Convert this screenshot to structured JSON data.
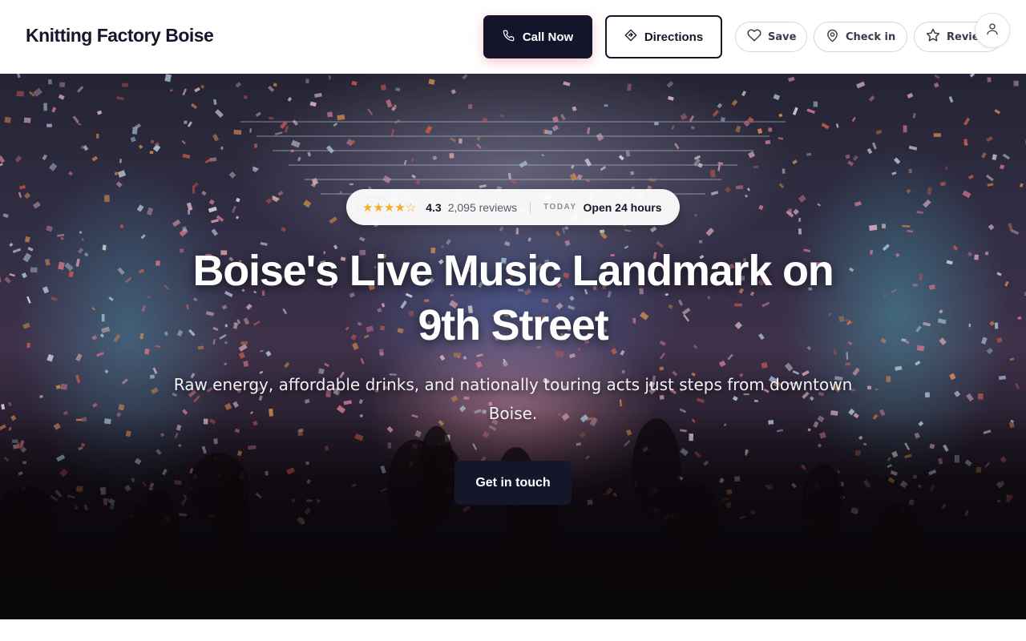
{
  "header": {
    "brand": "Knitting Factory Boise",
    "call_label": "Call Now",
    "directions_label": "Directions",
    "save_label": "Save",
    "checkin_label": "Check in",
    "review_label": "Review"
  },
  "hero": {
    "rating": {
      "stars_full": "★★★★",
      "stars_partial": "☆",
      "score": "4.3",
      "reviews": "2,095 reviews",
      "today_label": "TODAY",
      "hours": "Open 24 hours"
    },
    "headline": "Boise's Live Music Landmark on 9th Street",
    "subline": "Raw energy, affordable drinks, and nationally touring acts just steps from downtown Boise.",
    "cta_label": "Get in touch"
  },
  "colors": {
    "primary": "#16162a",
    "star": "#f2b01e",
    "background": "#ffffff"
  },
  "icons": {
    "call": "phone-icon",
    "directions": "directions-icon",
    "save": "heart-icon",
    "checkin": "map-pin-icon",
    "review": "star-icon",
    "account": "user-icon"
  }
}
